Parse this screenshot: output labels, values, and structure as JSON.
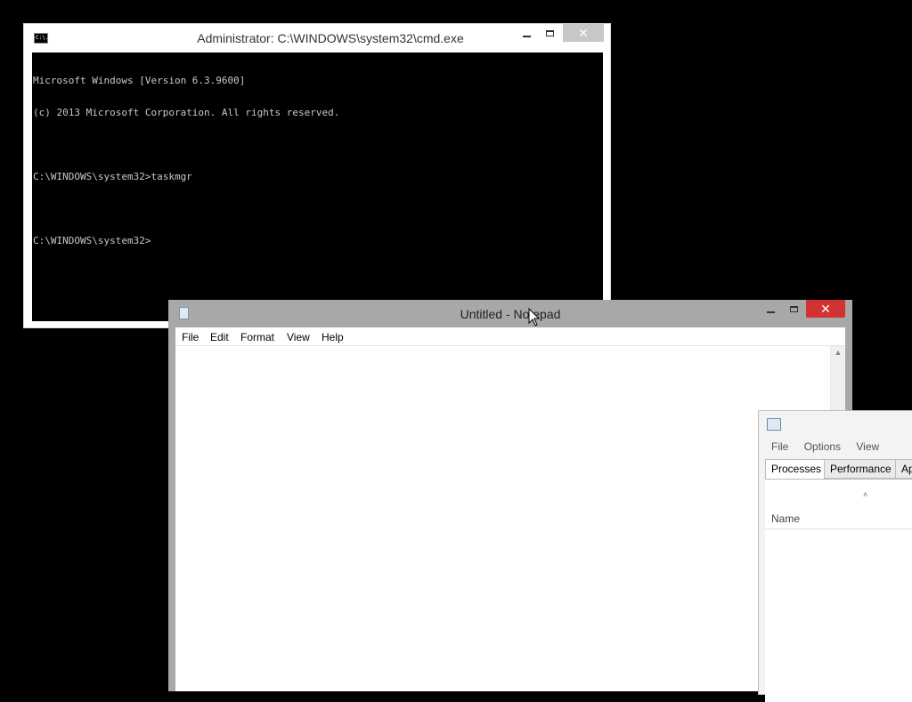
{
  "cmd": {
    "title": "Administrator: C:\\WINDOWS\\system32\\cmd.exe",
    "icon_text": "C:\\.",
    "lines": [
      "Microsoft Windows [Version 6.3.9600]",
      "(c) 2013 Microsoft Corporation. All rights reserved.",
      "",
      "C:\\WINDOWS\\system32>taskmgr",
      "",
      "C:\\WINDOWS\\system32>"
    ],
    "close_glyph": "✕"
  },
  "notepad": {
    "title": "Untitled - Notepad",
    "menu": [
      "File",
      "Edit",
      "Format",
      "View",
      "Help"
    ],
    "close_glyph": "✕",
    "scroll_up_glyph": "▲"
  },
  "taskmgr": {
    "menu": [
      "File",
      "Options",
      "View"
    ],
    "tabs": [
      "Processes",
      "Performance",
      "Ap"
    ],
    "sort_caret": "˄",
    "column_name": "Name"
  },
  "colors": {
    "cmd_close_inactive": "#c7c7c7",
    "notepad_close": "#d13232",
    "desktop": "#000000"
  }
}
